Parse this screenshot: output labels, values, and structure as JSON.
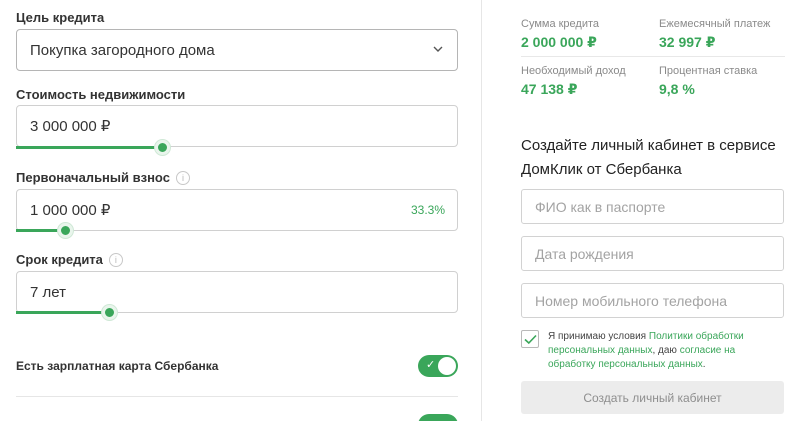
{
  "form": {
    "goal": {
      "label": "Цель кредита",
      "value": "Покупка загородного дома"
    },
    "property_cost": {
      "label": "Стоимость недвижимости",
      "value": "3 000 000 ₽",
      "slider_fraction": 0.33
    },
    "down_payment": {
      "label": "Первоначальный взнос",
      "value": "1 000 000 ₽",
      "percent": "33.3%",
      "slider_fraction": 0.11
    },
    "term": {
      "label": "Срок кредита",
      "value": "7 лет",
      "slider_fraction": 0.21
    },
    "salary_card": {
      "label": "Есть зарплатная карта Сбербанка",
      "enabled": true
    }
  },
  "summary": {
    "loan_amount": {
      "label": "Сумма кредита",
      "value": "2 000 000 ₽"
    },
    "monthly_payment": {
      "label": "Ежемесячный платеж",
      "value": "32 997 ₽"
    },
    "required_income": {
      "label": "Необходимый доход",
      "value": "47 138 ₽"
    },
    "interest_rate": {
      "label": "Процентная ставка",
      "value": "9,8 %"
    }
  },
  "signup": {
    "heading": "Создайте личный кабинет в сервисе ДомКлик от Сбербанка",
    "fio_placeholder": "ФИО как в паспорте",
    "birth_placeholder": "Дата рождения",
    "phone_placeholder": "Номер мобильного телефона",
    "consent": {
      "checked": true,
      "prefix": "Я принимаю условия ",
      "link1": "Политики обработки персональных данных",
      "middle": ", даю ",
      "link2": "согласие на обработку персональных данных",
      "suffix": "."
    },
    "submit_label": "Создать личный кабинет"
  },
  "colors": {
    "accent": "#3aa65a",
    "border": "#d0d0d0",
    "muted": "#8a8a8a"
  }
}
